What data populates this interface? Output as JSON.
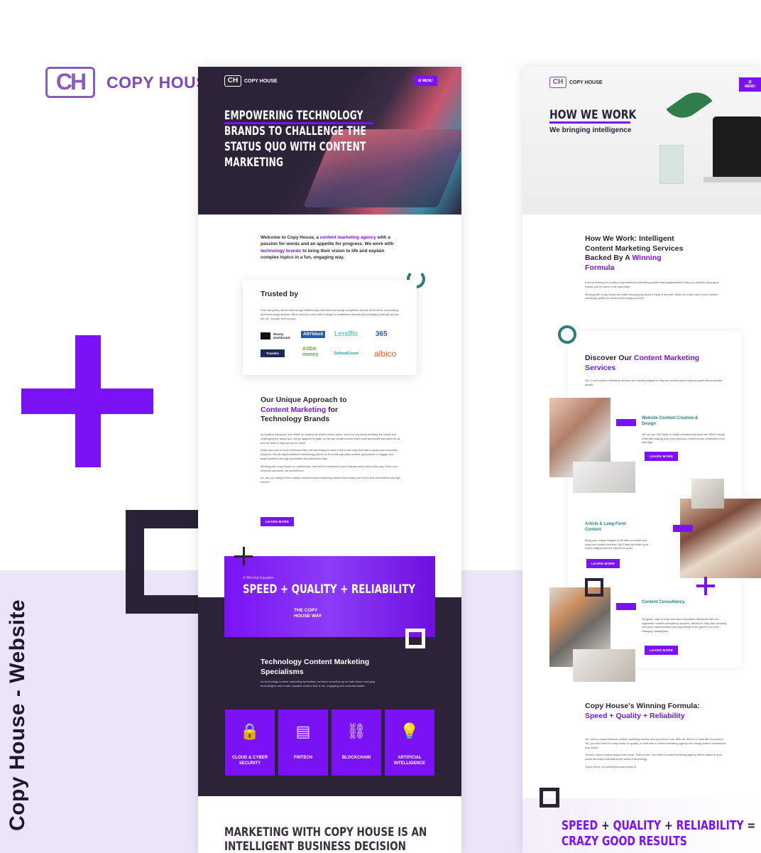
{
  "brand": {
    "logo_mark": "CH",
    "name": "COPY HOUSE",
    "caption": "Copy House - Website"
  },
  "colors": {
    "accent": "#7a12f5",
    "dark": "#2c2338",
    "teal": "#2a7f7a",
    "lavender": "#ece4f8"
  },
  "home": {
    "nav": {
      "logo_mark": "CH",
      "logo_text": "COPY HOUSE",
      "menu_label": "☰ MENU"
    },
    "hero_title": "EMPOWERING TECHNOLOGY BRANDS TO CHALLENGE THE STATUS QUO WITH CONTENT MARKETING",
    "intro": {
      "p1": "Welcome to Copy House, a ",
      "link1": "content marketing agency",
      "p2": " with a passion for words and an appetite for progress. We work with ",
      "link2": "technology brands",
      "p3": " to bring their vision to life and explain complex topics in a fun, engaging way."
    },
    "trusted": {
      "title": "Trusted by",
      "text": "Over the years, we've built strong relationships with some amazing companies across the finance, accounting, and technology sectors. We're proud to work with a range of established brands and emerging startups across the UK, Europe and beyond.",
      "logos": [
        "Money Dashboard",
        "ANYblock",
        "Lendflo",
        "365",
        "Travelex",
        "ASDA money",
        "DefinedCrowd",
        "albico"
      ]
    },
    "approach": {
      "h1": "Our Unique Approach to",
      "h2": "Content Marketing",
      "h3": " for",
      "h4": "Technology Brands",
      "p1": "As 'positive disruptors' who thrive on making the world a better place, we're not shy about breaking the mould and challenging the status quo. We go against the grain, so we can create a world that's more accessible and fairer for all and we want to help you do the same.",
      "p2": "When you work in such a technical field, the last thing you want is dry or dull copy that fails to grasp your innovative solutions. Our strong foundation in technology allows us to create specialist content, guaranteed to engage your target audience through accessible and purposeful copy.",
      "p3": "Working with Copy House is a partnership, and we'll be invested in your business every step of the way. When your business succeeds, we succeed too.",
      "p4": "So, are you ready to find a totally comprehensive marketing solution that means you'll work less and achieve sky-high results?",
      "button": "LEARN MORE"
    },
    "banner": {
      "kicker": "A Winning Equation",
      "headline": "SPEED + QUALITY + RELIABILITY",
      "way": "THE COPY HOUSE WAY"
    },
    "tech": {
      "title": "Technology Content Marketing Specialisms",
      "text": "As technology content marketing specialists, we keep ourselves up-to-date about emerging technologies and create valuable content that is fun, engaging and understandable.",
      "tiles": [
        {
          "label": "CLOUD & CYBER SECURITY",
          "icon": "lock-icon",
          "glyph": "🔒"
        },
        {
          "label": "FINTECH",
          "icon": "document-icon",
          "glyph": "▤"
        },
        {
          "label": "BLOCKCHAIN",
          "icon": "link-icon",
          "glyph": "⛓"
        },
        {
          "label": "ARTIFICIAL INTELLIGENCE",
          "icon": "lightbulb-icon",
          "glyph": "💡"
        }
      ]
    },
    "footer_title": "MARKETING WITH COPY HOUSE IS AN INTELLIGENT BUSINESS DECISION"
  },
  "how": {
    "nav": {
      "logo_mark": "CH",
      "logo_text": "COPY HOUSE",
      "menu_label": "☰ MENU"
    },
    "title": "HOW WE WORK",
    "subtitle": "We bringing intelligence",
    "heading": {
      "h1": "How We Work: Intelligent Content Marketing Services Backed By A",
      "h2": "Winning Formula"
    },
    "p1": "If you're looking for a totally comprehensive marketing solution that's guaranteed to help you achieve crazy good results, you've come to the right place.",
    "p2": "Working with Copy House will make winning long-hours a thing of the past. Allow us to take care of your content marketing, while you focus on the things you love.",
    "discover": {
      "h1": "Discover Our ",
      "h2": "Content Marketing Services",
      "text": "Our 3 core content marketing services are carefully aligned to help you achieve your business goals and accelerate growth."
    },
    "services": [
      {
        "title": "Website Content Creation & Design",
        "text": "We use our SEO skills to create websites that climb the SERP results, while also making sure your products or services are presented in the best light.",
        "button": "LEARN MORE"
      },
      {
        "title": "Article & Long-Form Content",
        "text": "Bring your unique insights to life with our article and long-form content services. We'll help you share your expert insights with the rest of the world.",
        "button": "LEARN MORE"
      },
      {
        "title": "Content Consultancy.",
        "text": "Set goals, stay on track and reach important milestones with our supportive content consultancy services. Tailored to help your company own your market position and stay ahead of the game in an ever-changing marketplace.",
        "button": "LEARN MORE"
      }
    ],
    "winning": {
      "h1": "Copy House's Winning Formula: ",
      "h2": "Speed + Quality + Reliability",
      "p1": "You need a comprehensive content marketing solution and you need it now. After all, there's no time like the present. Yet, you don't want to compromise on quality, or work with a content marketing agency who simply doesn't understand your sector.",
      "p2": "Generic, bland content simply won't work. That's a fact. You need a content marketing agency who's walked in your shoes and fully understands the world of technology.",
      "p3": "That's where our winning formula comes in."
    },
    "footer": {
      "a": "SPEED",
      "b": "QUALITY",
      "c": "RELIABILITY",
      "d": "CRAZY GOOD RESULTS"
    }
  }
}
